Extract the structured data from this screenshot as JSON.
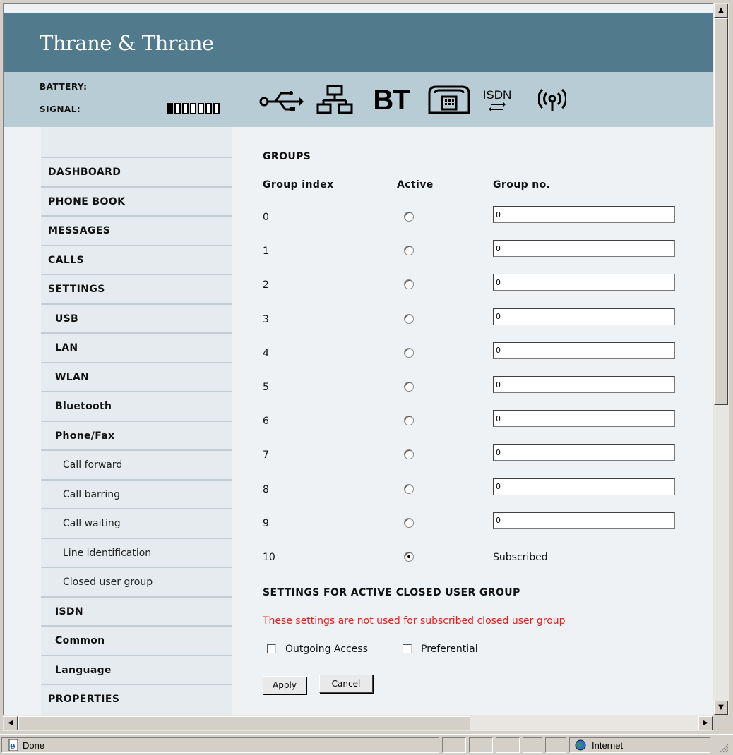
{
  "header": {
    "brand": "Thrane & Thrane",
    "battery_label": "BATTERY:",
    "signal_label": "SIGNAL:",
    "signal_level": 1,
    "signal_max": 7,
    "interface_icons": [
      "usb-icon",
      "lan-icon",
      "bluetooth-icon",
      "phone-fax-icon",
      "isdn-icon",
      "wlan-icon"
    ],
    "icon_texts": {
      "bluetooth": "BT",
      "isdn": "ISDN"
    }
  },
  "sidebar": {
    "items": [
      {
        "label": "DASHBOARD",
        "level": 1
      },
      {
        "label": "PHONE BOOK",
        "level": 1
      },
      {
        "label": "MESSAGES",
        "level": 1
      },
      {
        "label": "CALLS",
        "level": 1
      },
      {
        "label": "SETTINGS",
        "level": 1
      },
      {
        "label": "USB",
        "level": 2
      },
      {
        "label": "LAN",
        "level": 2
      },
      {
        "label": "WLAN",
        "level": 2
      },
      {
        "label": "Bluetooth",
        "level": 2
      },
      {
        "label": "Phone/Fax",
        "level": 2
      },
      {
        "label": "Call forward",
        "level": 3
      },
      {
        "label": "Call barring",
        "level": 3
      },
      {
        "label": "Call waiting",
        "level": 3
      },
      {
        "label": "Line identification",
        "level": 3
      },
      {
        "label": "Closed user group",
        "level": 3
      },
      {
        "label": "ISDN",
        "level": 2
      },
      {
        "label": "Common",
        "level": 2
      },
      {
        "label": "Language",
        "level": 2
      },
      {
        "label": "PROPERTIES",
        "level": 1
      }
    ]
  },
  "groups": {
    "title": "GROUPS",
    "columns": [
      "Group index",
      "Active",
      "Group no."
    ],
    "rows": [
      {
        "index": "0",
        "active": false,
        "group_no": "0"
      },
      {
        "index": "1",
        "active": false,
        "group_no": "0"
      },
      {
        "index": "2",
        "active": false,
        "group_no": "0"
      },
      {
        "index": "3",
        "active": false,
        "group_no": "0"
      },
      {
        "index": "4",
        "active": false,
        "group_no": "0"
      },
      {
        "index": "5",
        "active": false,
        "group_no": "0"
      },
      {
        "index": "6",
        "active": false,
        "group_no": "0"
      },
      {
        "index": "7",
        "active": false,
        "group_no": "0"
      },
      {
        "index": "8",
        "active": false,
        "group_no": "0"
      },
      {
        "index": "9",
        "active": false,
        "group_no": "0"
      },
      {
        "index": "10",
        "active": true,
        "group_no": "Subscribed"
      }
    ]
  },
  "active_settings": {
    "title": "SETTINGS FOR ACTIVE CLOSED USER GROUP",
    "warning": "These settings are not used for subscribed closed user group",
    "warning_color": "#e81c1c",
    "outgoing_access_label": "Outgoing Access",
    "outgoing_access_checked": false,
    "preferential_label": "Preferential",
    "preferential_checked": false,
    "apply_label": "Apply",
    "cancel_label": "Cancel"
  },
  "browser_status": {
    "status_text": "Done",
    "zone_text": "Internet"
  },
  "colors": {
    "brand_bar": "#517a8c",
    "status_bar": "#b7ccd4",
    "sidebar": "#e5ebee",
    "content": "#eef2f5"
  }
}
